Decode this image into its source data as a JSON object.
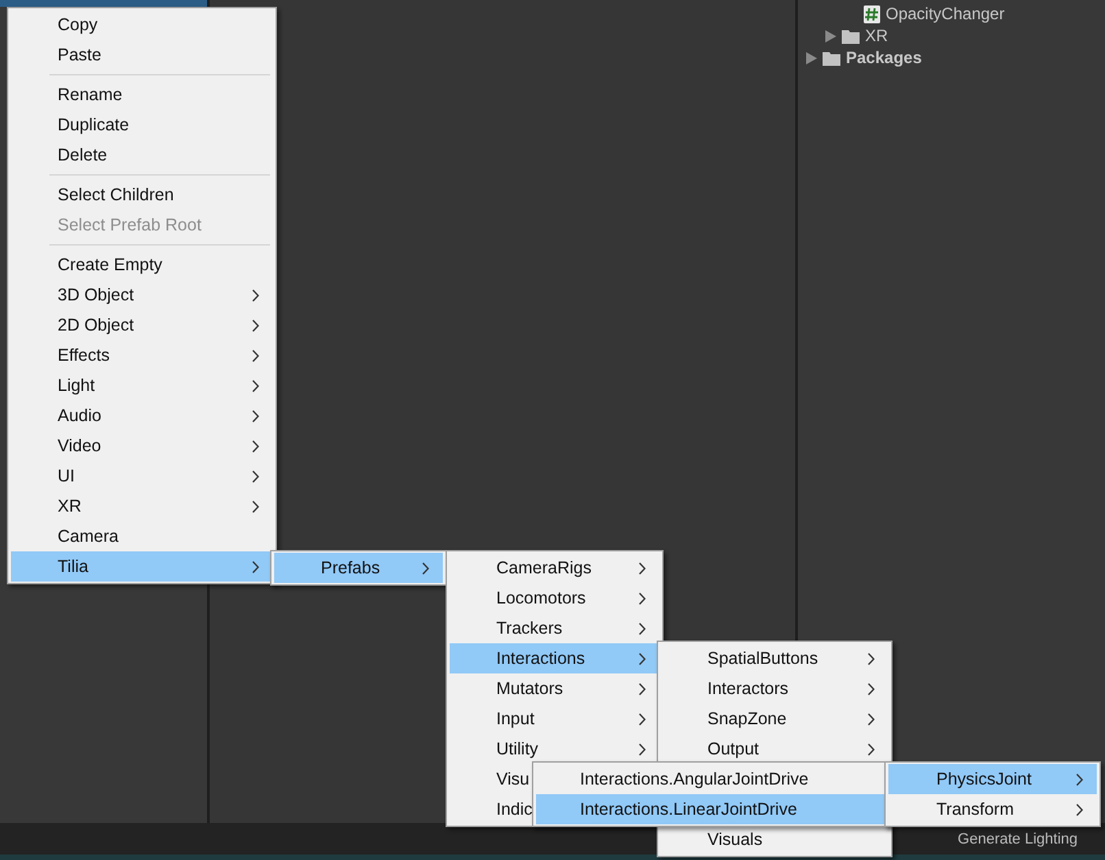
{
  "project_tree": [
    {
      "label": "OpacityChanger",
      "kind": "script"
    },
    {
      "label": "XR",
      "kind": "folder"
    },
    {
      "label": "Packages",
      "kind": "root"
    }
  ],
  "status_bar": {
    "text": "Generate Lighting"
  },
  "menus": [
    {
      "items": [
        {
          "kind": "item",
          "label": "Copy",
          "selected": false,
          "disabled": false,
          "submenu": false
        },
        {
          "kind": "item",
          "label": "Paste",
          "selected": false,
          "disabled": false,
          "submenu": false
        },
        {
          "kind": "separator"
        },
        {
          "kind": "item",
          "label": "Rename",
          "selected": false,
          "disabled": false,
          "submenu": false
        },
        {
          "kind": "item",
          "label": "Duplicate",
          "selected": false,
          "disabled": false,
          "submenu": false
        },
        {
          "kind": "item",
          "label": "Delete",
          "selected": false,
          "disabled": false,
          "submenu": false
        },
        {
          "kind": "separator"
        },
        {
          "kind": "item",
          "label": "Select Children",
          "selected": false,
          "disabled": false,
          "submenu": false
        },
        {
          "kind": "item",
          "label": "Select Prefab Root",
          "selected": false,
          "disabled": true,
          "submenu": false
        },
        {
          "kind": "separator"
        },
        {
          "kind": "item",
          "label": "Create Empty",
          "selected": false,
          "disabled": false,
          "submenu": false
        },
        {
          "kind": "item",
          "label": "3D Object",
          "selected": false,
          "disabled": false,
          "submenu": true
        },
        {
          "kind": "item",
          "label": "2D Object",
          "selected": false,
          "disabled": false,
          "submenu": true
        },
        {
          "kind": "item",
          "label": "Effects",
          "selected": false,
          "disabled": false,
          "submenu": true
        },
        {
          "kind": "item",
          "label": "Light",
          "selected": false,
          "disabled": false,
          "submenu": true
        },
        {
          "kind": "item",
          "label": "Audio",
          "selected": false,
          "disabled": false,
          "submenu": true
        },
        {
          "kind": "item",
          "label": "Video",
          "selected": false,
          "disabled": false,
          "submenu": true
        },
        {
          "kind": "item",
          "label": "UI",
          "selected": false,
          "disabled": false,
          "submenu": true
        },
        {
          "kind": "item",
          "label": "XR",
          "selected": false,
          "disabled": false,
          "submenu": true
        },
        {
          "kind": "item",
          "label": "Camera",
          "selected": false,
          "disabled": false,
          "submenu": false
        },
        {
          "kind": "item",
          "label": "Tilia",
          "selected": true,
          "disabled": false,
          "submenu": true
        }
      ]
    },
    {
      "items": [
        {
          "kind": "item",
          "label": "Prefabs",
          "selected": true,
          "disabled": false,
          "submenu": true
        }
      ]
    },
    {
      "items": [
        {
          "kind": "item",
          "label": "CameraRigs",
          "selected": false,
          "disabled": false,
          "submenu": true
        },
        {
          "kind": "item",
          "label": "Locomotors",
          "selected": false,
          "disabled": false,
          "submenu": true
        },
        {
          "kind": "item",
          "label": "Trackers",
          "selected": false,
          "disabled": false,
          "submenu": true
        },
        {
          "kind": "item",
          "label": "Interactions",
          "selected": true,
          "disabled": false,
          "submenu": true
        },
        {
          "kind": "item",
          "label": "Mutators",
          "selected": false,
          "disabled": false,
          "submenu": true
        },
        {
          "kind": "item",
          "label": "Input",
          "selected": false,
          "disabled": false,
          "submenu": true
        },
        {
          "kind": "item",
          "label": "Utility",
          "selected": false,
          "disabled": false,
          "submenu": true
        },
        {
          "kind": "item",
          "label": "Visu",
          "selected": false,
          "disabled": false,
          "submenu": false
        },
        {
          "kind": "item",
          "label": "Indic",
          "selected": false,
          "disabled": false,
          "submenu": false
        }
      ]
    },
    {
      "items": [
        {
          "kind": "item",
          "label": "SpatialButtons",
          "selected": false,
          "disabled": false,
          "submenu": true
        },
        {
          "kind": "item",
          "label": "Interactors",
          "selected": false,
          "disabled": false,
          "submenu": true
        },
        {
          "kind": "item",
          "label": "SnapZone",
          "selected": false,
          "disabled": false,
          "submenu": true
        },
        {
          "kind": "item",
          "label": "Output",
          "selected": false,
          "disabled": false,
          "submenu": true
        },
        {
          "kind": "hidden"
        },
        {
          "kind": "hidden"
        },
        {
          "kind": "item",
          "label": "Visuals",
          "selected": false,
          "disabled": false,
          "submenu": false
        }
      ]
    },
    {
      "items": [
        {
          "kind": "item",
          "label": "Interactions.AngularJointDrive",
          "selected": false,
          "disabled": false,
          "submenu": false
        },
        {
          "kind": "item",
          "label": "Interactions.LinearJointDrive",
          "selected": true,
          "disabled": false,
          "submenu": false
        }
      ]
    },
    {
      "items": [
        {
          "kind": "item",
          "label": "PhysicsJoint",
          "selected": true,
          "disabled": false,
          "submenu": true
        },
        {
          "kind": "item",
          "label": "Transform",
          "selected": false,
          "disabled": false,
          "submenu": true
        }
      ]
    }
  ]
}
